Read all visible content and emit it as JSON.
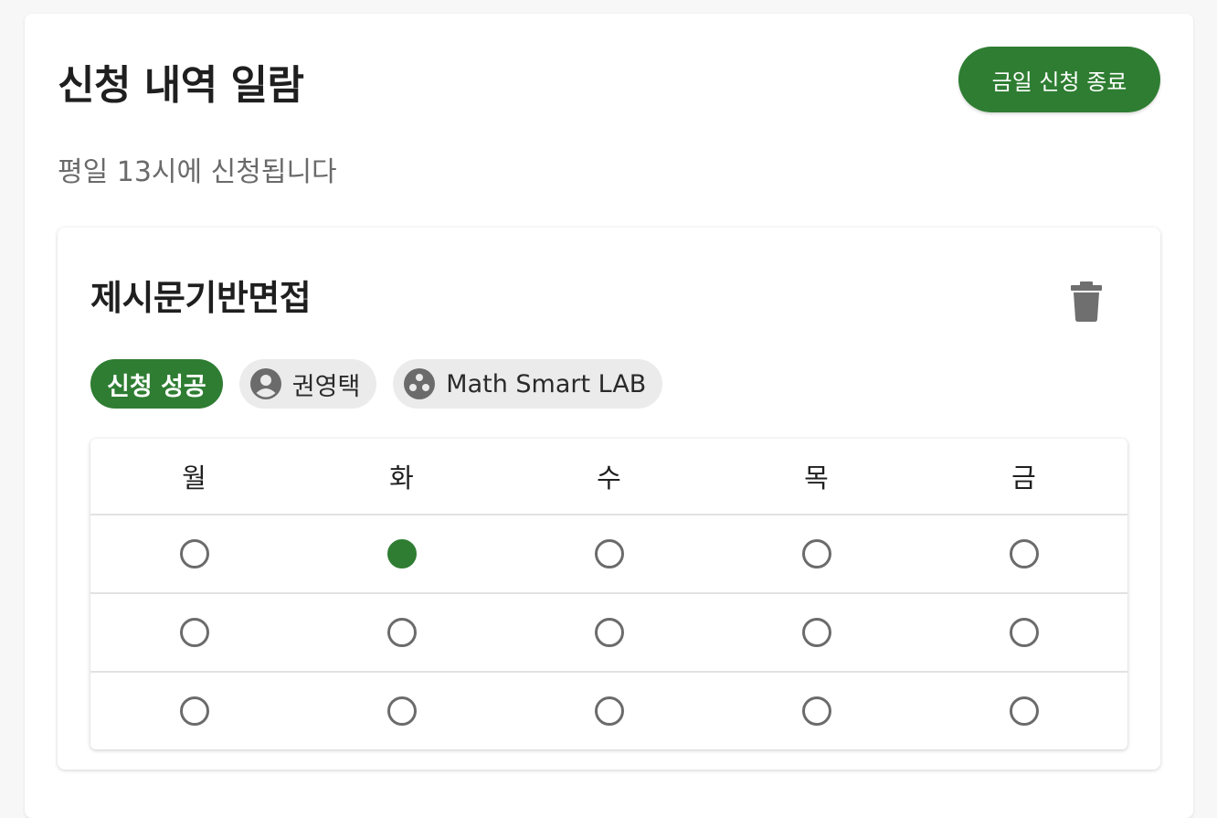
{
  "header": {
    "title": "신청 내역 일람",
    "end_button_label": "금일 신청 종료",
    "subtitle": "평일 13시에 신청됩니다"
  },
  "application": {
    "course_title": "제시문기반면접",
    "status_chip": "신청 성공",
    "person_chip": "권영택",
    "location_chip": "Math Smart LAB",
    "icons": {
      "delete": "trash-icon",
      "person": "account-circle-icon",
      "location": "group-circles-icon"
    }
  },
  "schedule": {
    "days": [
      "월",
      "화",
      "수",
      "목",
      "금"
    ],
    "rows": [
      [
        false,
        true,
        false,
        false,
        false
      ],
      [
        false,
        false,
        false,
        false,
        false
      ],
      [
        false,
        false,
        false,
        false,
        false
      ]
    ]
  },
  "colors": {
    "accent": "#2e7d32",
    "chip_bg": "#ebebeb",
    "radio_border": "#6b6b6b"
  }
}
